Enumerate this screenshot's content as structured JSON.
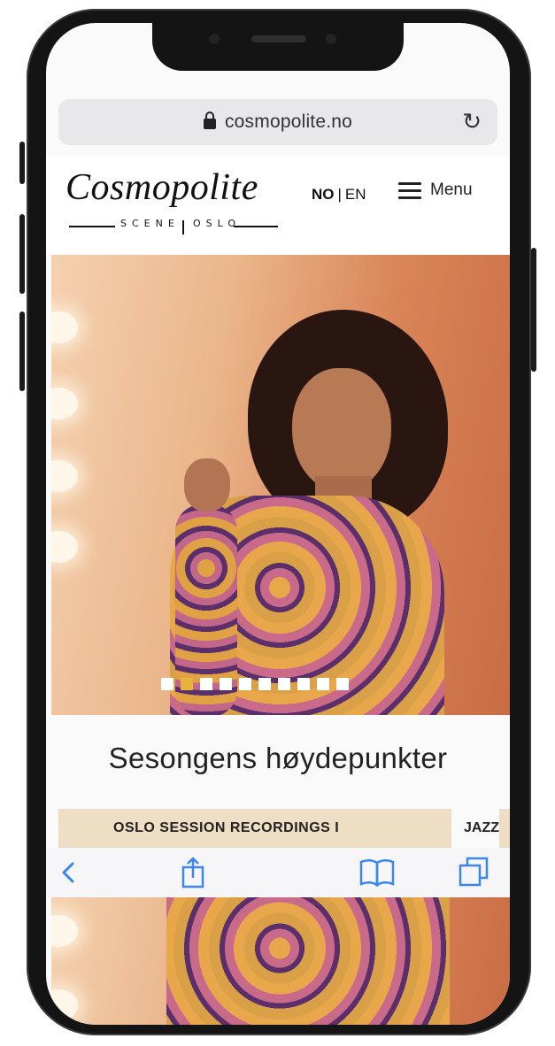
{
  "browser": {
    "url": "cosmopolite.no"
  },
  "header": {
    "logo_text": "Cosmopolite",
    "logo_sub_left": "SCENE",
    "logo_sub_right": "OSLO",
    "lang_active": "NO",
    "lang_separator": "|",
    "lang_other": "EN",
    "menu_label": "Menu"
  },
  "hero": {
    "slide_count": 10,
    "active_slide": 1
  },
  "section": {
    "title": "Sesongens høydepunkter"
  },
  "event_strip": {
    "title": "OSLO SESSION RECORDINGS I",
    "tag": "JAZZ"
  },
  "toolbar": {
    "icons": [
      "back-icon",
      "share-icon",
      "bookmarks-icon",
      "tabs-icon"
    ]
  },
  "colors": {
    "accent_dot": "#e7b33d",
    "ios_blue": "#3a86f0",
    "strip_bg": "#eedfc4"
  }
}
